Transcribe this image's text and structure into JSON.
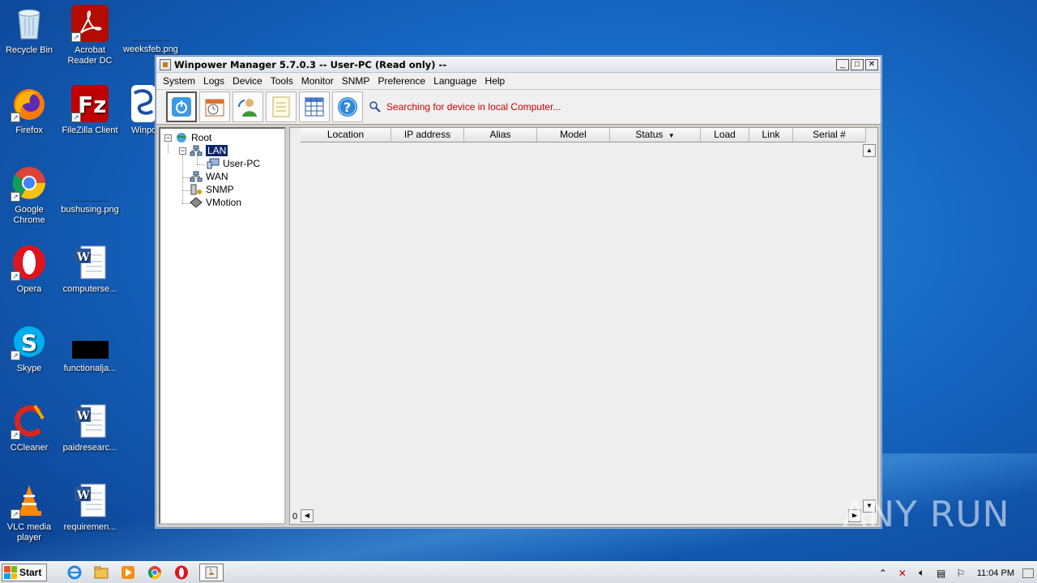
{
  "desktop": {
    "icons": [
      {
        "label": "Recycle Bin"
      },
      {
        "label": "Acrobat Reader DC"
      },
      {
        "label": "weeksfeb.png"
      },
      {
        "label": "Firefox"
      },
      {
        "label": "FileZilla Client"
      },
      {
        "label": "Winpo"
      },
      {
        "label": "Google Chrome"
      },
      {
        "label": "bushusing.png"
      },
      {
        "label": "Opera"
      },
      {
        "label": "computerse..."
      },
      {
        "label": "Skype"
      },
      {
        "label": "functionalja..."
      },
      {
        "label": "CCleaner"
      },
      {
        "label": "paidresearc..."
      },
      {
        "label": "VLC media player"
      },
      {
        "label": "requiremen..."
      }
    ]
  },
  "window": {
    "title": "Winpower Manager 5.7.0.3 -- User-PC (Read only) --",
    "menu": [
      "System",
      "Logs",
      "Device",
      "Tools",
      "Monitor",
      "SNMP",
      "Preference",
      "Language",
      "Help"
    ],
    "status_message": "Searching for device in local Computer...",
    "tree": {
      "root": "Root",
      "lan": "LAN",
      "user_pc": "User-PC",
      "wan": "WAN",
      "snmp": "SNMP",
      "vmotion": "VMotion"
    },
    "table": {
      "columns": [
        "Location",
        "IP address",
        "Alias",
        "Model",
        "Status",
        "Load",
        "Link",
        "Serial #"
      ],
      "sort_indicator": "▼",
      "row_count": "0"
    }
  },
  "taskbar": {
    "start_label": "Start",
    "clock": "11:04 PM"
  },
  "watermark": "ANY RUN"
}
